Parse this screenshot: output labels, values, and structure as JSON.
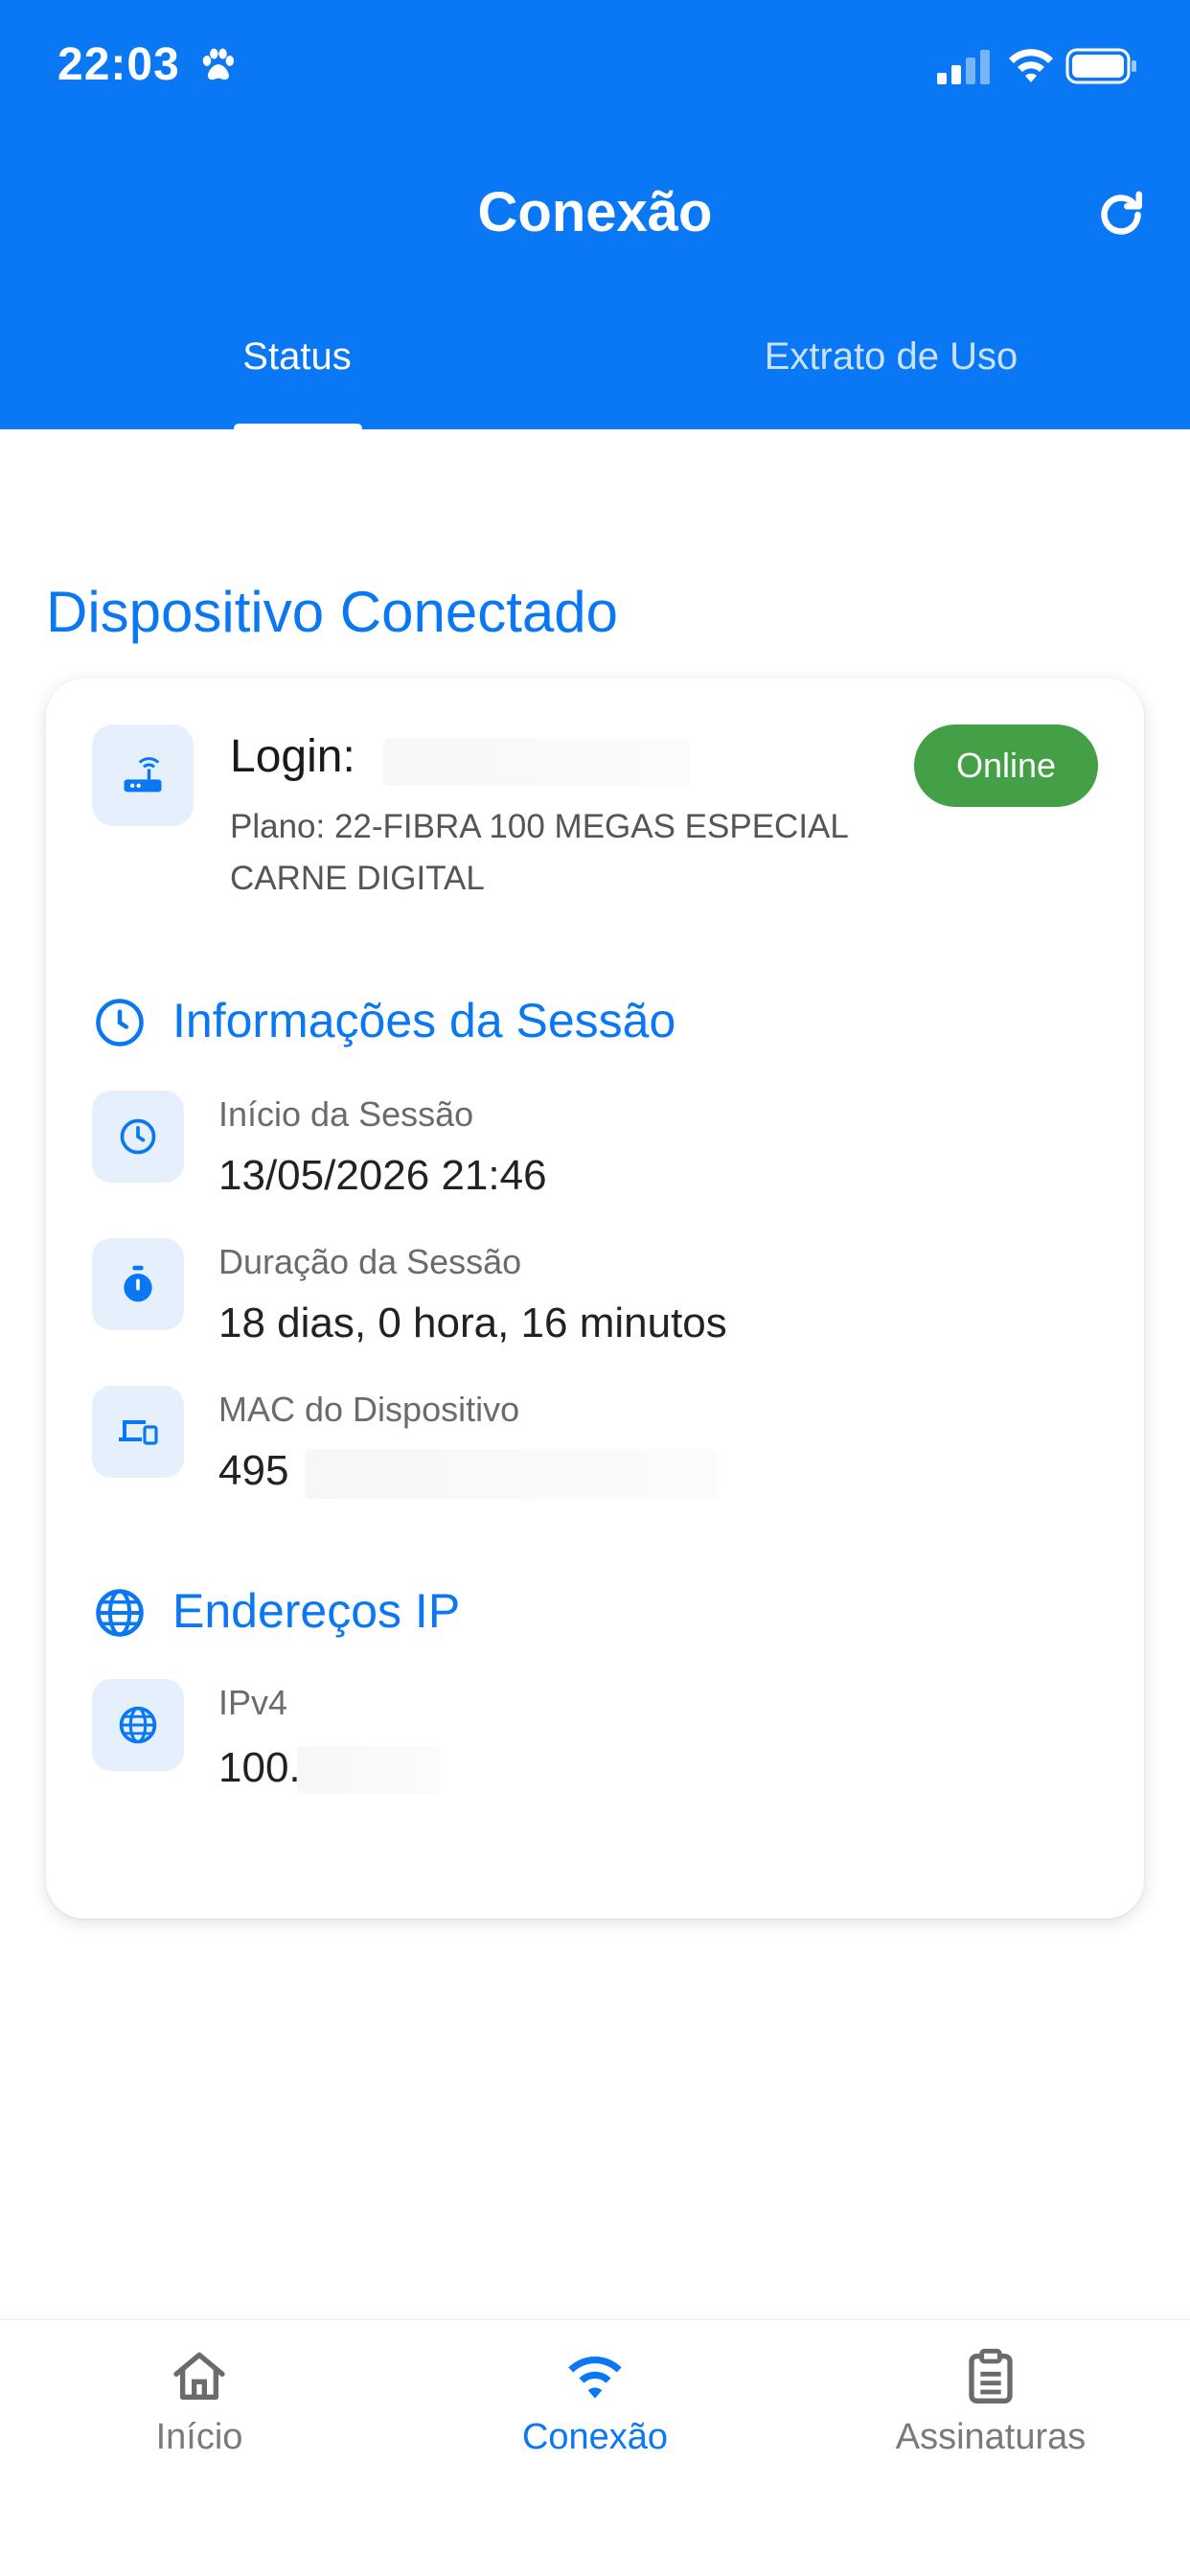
{
  "status_bar": {
    "time": "22:03"
  },
  "header": {
    "title": "Conexão",
    "tabs": [
      {
        "label": "Status"
      },
      {
        "label": "Extrato de Uso"
      }
    ]
  },
  "main": {
    "section_title": "Dispositivo Conectado",
    "device": {
      "login_label": "Login:",
      "plan": "Plano: 22-FIBRA 100 MEGAS ESPECIAL CARNE DIGITAL",
      "status": "Online"
    },
    "session": {
      "heading": "Informações da Sessão",
      "fields": [
        {
          "label": "Início da Sessão",
          "value": "13/05/2026 21:46",
          "icon": "clock-icon"
        },
        {
          "label": "Duração da Sessão",
          "value": "18 dias, 0 hora, 16 minutos",
          "icon": "stopwatch-icon"
        },
        {
          "label": "MAC do Dispositivo",
          "value": "495",
          "icon": "devices-icon"
        }
      ]
    },
    "ip": {
      "heading": "Endereços IP",
      "fields": [
        {
          "label": "IPv4",
          "value": "100.",
          "icon": "globe-icon"
        }
      ]
    }
  },
  "bottom_nav": {
    "items": [
      {
        "label": "Início",
        "icon": "home-icon"
      },
      {
        "label": "Conexão",
        "icon": "wifi-icon"
      },
      {
        "label": "Assinaturas",
        "icon": "clipboard-icon"
      }
    ]
  },
  "colors": {
    "primary": "#0a77f5",
    "online": "#43a047",
    "icon_bg": "#e6f0fd"
  }
}
